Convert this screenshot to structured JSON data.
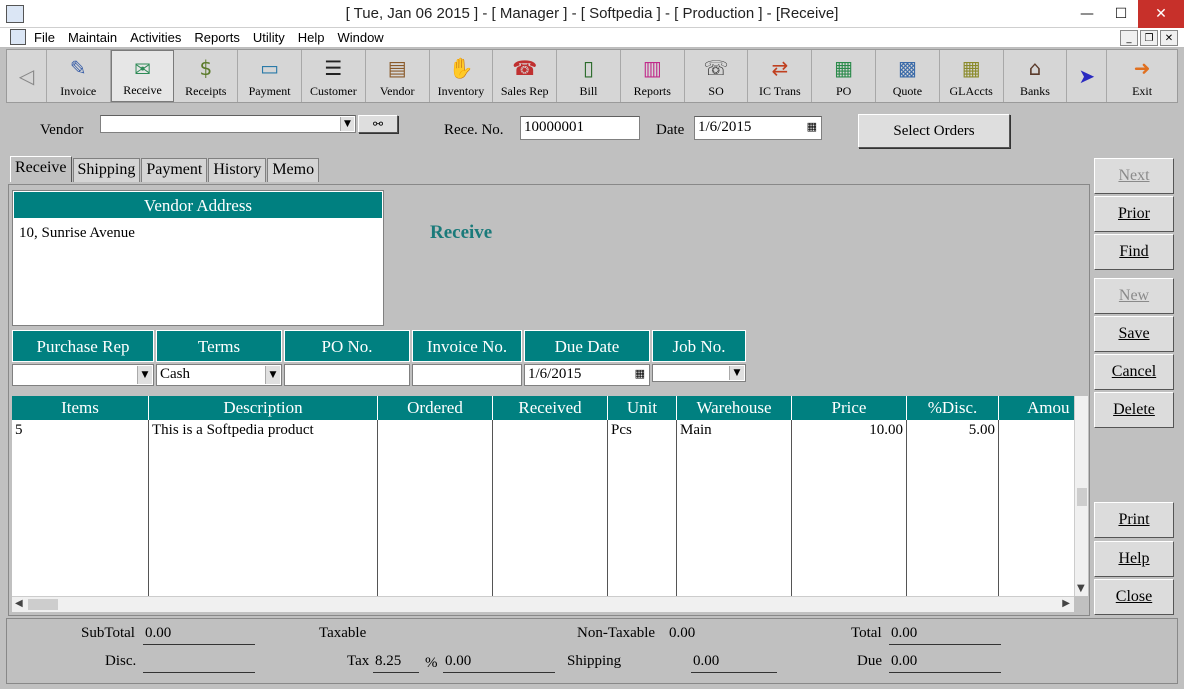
{
  "window": {
    "title": "[ Tue, Jan 06 2015 ] - [ Manager ] - [ Softpedia ] - [ Production ] - [Receive]",
    "min": "—",
    "max": "☐",
    "close": "✕"
  },
  "menu": {
    "items": [
      "File",
      "Maintain",
      "Activities",
      "Reports",
      "Utility",
      "Help",
      "Window"
    ],
    "mdi": [
      "_",
      "❐",
      "✕"
    ]
  },
  "toolbar": {
    "back": "◁",
    "more": "➤",
    "buttons": [
      {
        "label": "Invoice",
        "icon": "✎"
      },
      {
        "label": "Receive",
        "icon": "✉"
      },
      {
        "label": "Receipts",
        "icon": "$"
      },
      {
        "label": "Payment",
        "icon": "▭"
      },
      {
        "label": "Customer",
        "icon": "☰"
      },
      {
        "label": "Vendor",
        "icon": "▤"
      },
      {
        "label": "Inventory",
        "icon": "✋"
      },
      {
        "label": "Sales Rep",
        "icon": "☎"
      },
      {
        "label": "Bill",
        "icon": "▯"
      },
      {
        "label": "Reports",
        "icon": "▥"
      },
      {
        "label": "SO",
        "icon": "☏"
      },
      {
        "label": "IC Trans",
        "icon": "⇄"
      },
      {
        "label": "PO",
        "icon": "▦"
      },
      {
        "label": "Quote",
        "icon": "▩"
      },
      {
        "label": "GLAccts",
        "icon": "▦"
      },
      {
        "label": "Banks",
        "icon": "⌂"
      }
    ],
    "exit": {
      "label": "Exit",
      "icon": "➜"
    }
  },
  "header": {
    "vendor_label": "Vendor",
    "vendor_value": "",
    "binoculars": "⚯",
    "rece_no_label": "Rece. No.",
    "rece_no_value": "10000001",
    "date_label": "Date",
    "date_value": "1/6/2015",
    "select_orders": "Select Orders"
  },
  "tabs": [
    "Receive",
    "Shipping",
    "Payment",
    "History",
    "Memo"
  ],
  "vendor_address": {
    "title": "Vendor Address",
    "line1": "10, Sunrise Avenue"
  },
  "section_title": "Receive",
  "info": {
    "purchase_rep": {
      "label": "Purchase Rep",
      "value": ""
    },
    "terms": {
      "label": "Terms",
      "value": "Cash"
    },
    "po_no": {
      "label": "PO No.",
      "value": ""
    },
    "invoice_no": {
      "label": "Invoice No.",
      "value": ""
    },
    "due_date": {
      "label": "Due Date",
      "value": "1/6/2015"
    },
    "job_no": {
      "label": "Job No.",
      "value": ""
    }
  },
  "items": {
    "columns": [
      "Items",
      "Description",
      "Ordered",
      "Received",
      "Unit",
      "Warehouse",
      "Price",
      "%Disc.",
      "Amou"
    ],
    "rows": [
      {
        "item": "5",
        "description": "This is a Softpedia product",
        "ordered": "",
        "received": "",
        "unit": "Pcs",
        "warehouse": "Main",
        "price": "10.00",
        "disc": "5.00",
        "amount": ""
      }
    ]
  },
  "side_buttons": [
    {
      "label": "Next",
      "disabled": true
    },
    {
      "label": "Prior",
      "disabled": false
    },
    {
      "label": "Find",
      "disabled": false
    },
    {
      "label": "New",
      "disabled": true
    },
    {
      "label": "Save",
      "disabled": false
    },
    {
      "label": "Cancel",
      "disabled": false
    },
    {
      "label": "Delete",
      "disabled": false
    },
    {
      "label": "Print",
      "disabled": false
    },
    {
      "label": "Help",
      "disabled": false
    },
    {
      "label": "Close",
      "disabled": false
    }
  ],
  "footer": {
    "subtotal_label": "SubTotal",
    "subtotal_value": "0.00",
    "taxable_label": "Taxable",
    "nontaxable_label": "Non-Taxable",
    "nontaxable_value": "0.00",
    "total_label": "Total",
    "total_value": "0.00",
    "disc_label": "Disc.",
    "disc_value": "",
    "tax_label": "Tax",
    "tax_rate": "8.25",
    "percent": "%",
    "tax_value": "0.00",
    "shipping_label": "Shipping",
    "shipping_value": "0.00",
    "due_label": "Due",
    "due_value": "0.00"
  }
}
